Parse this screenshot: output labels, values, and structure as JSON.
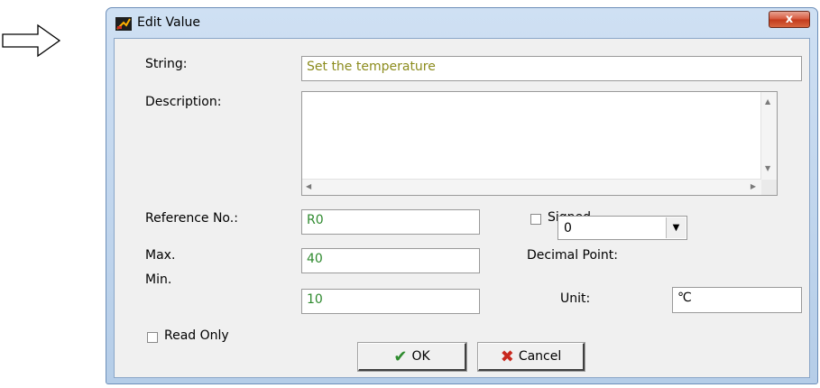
{
  "window": {
    "title": "Edit Value",
    "close_label": "x"
  },
  "form": {
    "string_label": "String:",
    "string_value": "Set the temperature",
    "description_label": "Description:",
    "description_value": "",
    "reference_label": "Reference No.:",
    "reference_value": "R0",
    "signed_label": "Signed",
    "signed_checked": false,
    "max_label": "Max.",
    "max_value": "40",
    "decimal_label": "Decimal Point:",
    "decimal_value": "0",
    "min_label": "Min.",
    "min_value": "10",
    "unit_label": "Unit:",
    "unit_value": "℃",
    "readonly_label": "Read Only",
    "readonly_checked": false
  },
  "buttons": {
    "ok_label": "OK",
    "cancel_label": "Cancel"
  },
  "icons": {
    "pointer": "right-arrow-icon",
    "app": "edit-app-icon",
    "close": "close-icon",
    "ok": "check-icon",
    "cancel": "x-icon"
  },
  "colors": {
    "string_value": "#8c8c1e",
    "numeric_values": "#2f8a2f",
    "close_button": "#d7583c"
  }
}
